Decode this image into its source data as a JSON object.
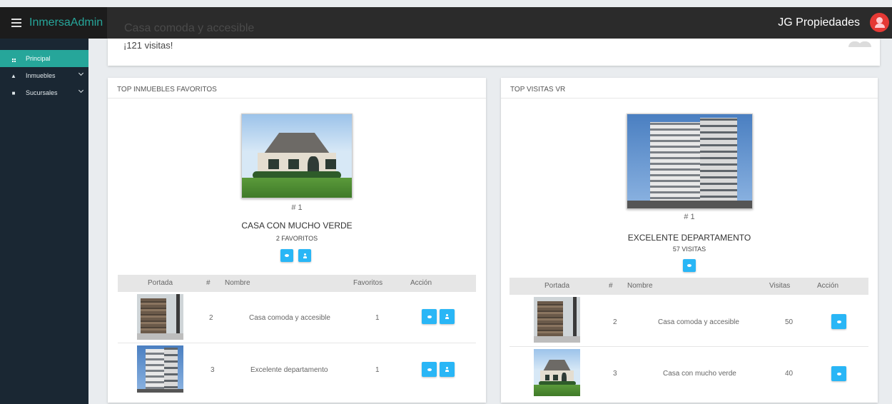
{
  "app": {
    "brand": "InmersaAdmin",
    "company": "JG Propiedades"
  },
  "header": {
    "ghost_title": "Casa comoda y accesible"
  },
  "sidebar": {
    "items": [
      {
        "label": "Principal",
        "icon": "grid-icon",
        "active": true
      },
      {
        "label": "Inmuebles",
        "icon": "home-icon",
        "expandable": true
      },
      {
        "label": "Sucursales",
        "icon": "briefcase-icon",
        "expandable": true
      }
    ]
  },
  "info": {
    "visits": "¡121 visitas!"
  },
  "favorites": {
    "title": "TOP INMUEBLES FAVORITOS",
    "featured": {
      "rank": "# 1",
      "name": "CASA CON MUCHO VERDE",
      "count": "2 FAVORITOS"
    },
    "columns": [
      "Portada",
      "#",
      "Nombre",
      "Favoritos",
      "Acción"
    ],
    "rows": [
      {
        "num": "2",
        "name": "Casa comoda y accesible",
        "value": "1",
        "image": "stone-house"
      },
      {
        "num": "3",
        "name": "Excelente departamento",
        "value": "1",
        "image": "apartment-building"
      }
    ]
  },
  "visits_vr": {
    "title": "TOP VISITAS VR",
    "featured": {
      "rank": "# 1",
      "name": "EXCELENTE DEPARTAMENTO",
      "count": "57 VISITAS"
    },
    "columns": [
      "Portada",
      "#",
      "Nombre",
      "Visitas",
      "Acción"
    ],
    "rows": [
      {
        "num": "2",
        "name": "Casa comoda y accesible",
        "value": "50",
        "image": "stone-house"
      },
      {
        "num": "3",
        "name": "Casa con mucho verde",
        "value": "40",
        "image": "green-house"
      }
    ]
  },
  "colors": {
    "accent": "#26a69a",
    "button": "#29b6f6",
    "sidebar": "#1a2733",
    "topbar": "#2b2b2b",
    "avatar": "#e53935"
  }
}
